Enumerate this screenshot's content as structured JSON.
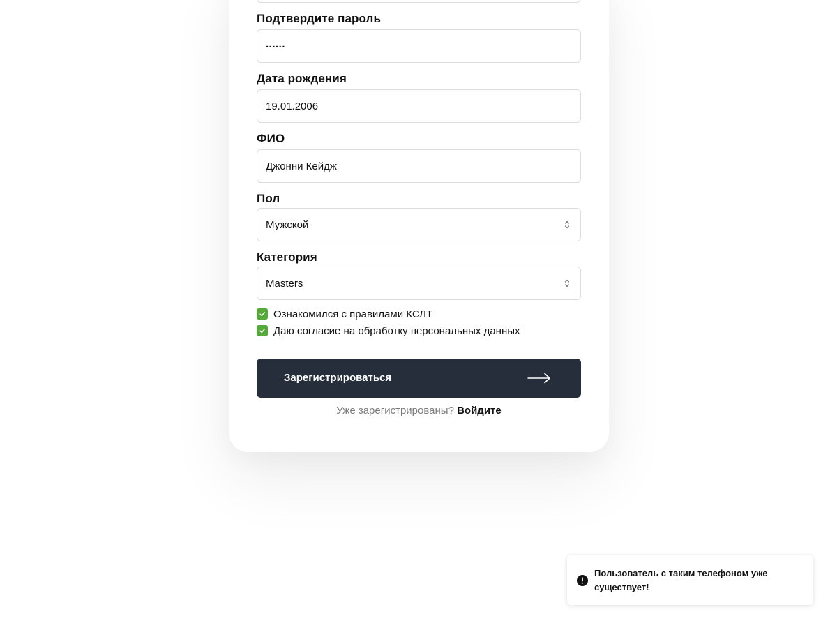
{
  "form": {
    "confirm_password": {
      "label": "Подтвердите пароль",
      "value": "......"
    },
    "birth_date": {
      "label": "Дата рождения",
      "value": "19.01.2006"
    },
    "full_name": {
      "label": "ФИО",
      "value": "Джонни Кейдж"
    },
    "gender": {
      "label": "Пол",
      "value": "Мужской"
    },
    "category": {
      "label": "Категория",
      "value": "Masters"
    },
    "checkboxes": [
      {
        "label": "Ознакомился с правилами КСЛТ",
        "checked": true
      },
      {
        "label": "Даю согласие на обработку персональных данных",
        "checked": true
      }
    ],
    "submit_label": "Зарегистрироваться",
    "login_prompt": "Уже зарегистрированы?",
    "login_link": "Войдите"
  },
  "toast": {
    "icon": "exclamation-circle-icon",
    "message": "Пользователь с таким телефоном уже существует!"
  },
  "colors": {
    "accent_green": "#55a93a",
    "button_bg": "#272e3b"
  }
}
